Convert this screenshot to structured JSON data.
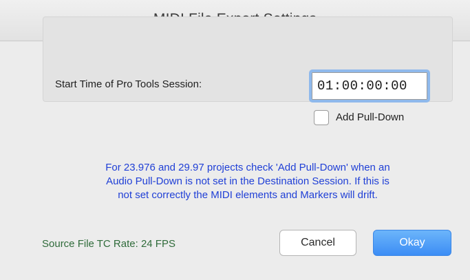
{
  "window": {
    "title": "MIDI File Export Settings"
  },
  "session": {
    "start_time_label": "Start Time of Pro Tools Session:",
    "start_time_value": "01:00:00:00",
    "pulldown_label": "Add Pull-Down",
    "pulldown_checked": false
  },
  "notice": {
    "lines": [
      "For 23.976 and 29.97 projects check 'Add Pull-Down' when an",
      "Audio Pull-Down is not set in the Destination Session. If this is",
      "not set correctly the MIDI elements and Markers will drift."
    ],
    "color": "#1f3fd6"
  },
  "footer": {
    "rate_label": "Source File TC Rate: 24 FPS",
    "rate_color": "#2f6b3a",
    "cancel_label": "Cancel",
    "okay_label": "Okay",
    "accent_color": "#3c8df5"
  }
}
